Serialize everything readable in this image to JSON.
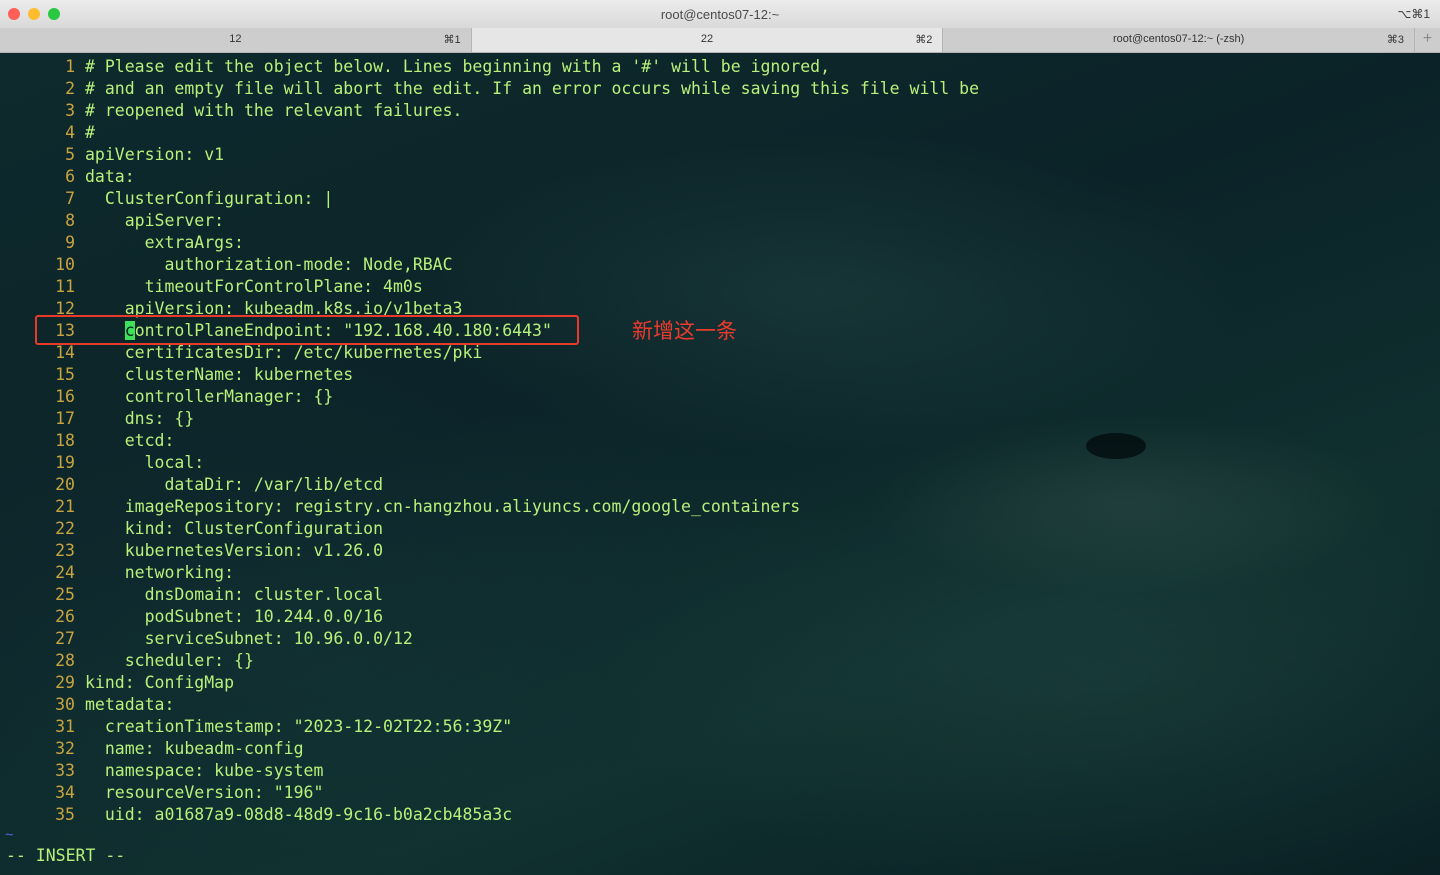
{
  "window": {
    "title": "root@centos07-12:~",
    "shortcut": "⌥⌘1"
  },
  "tabs": [
    {
      "label": "12",
      "key": "⌘1"
    },
    {
      "label": "22",
      "key": "⌘2"
    },
    {
      "label": "root@centos07-12:~ (-zsh)",
      "key": "⌘3"
    }
  ],
  "tab_add": "+",
  "editor": {
    "lines": [
      "# Please edit the object below. Lines beginning with a '#' will be ignored,",
      "# and an empty file will abort the edit. If an error occurs while saving this file will be",
      "# reopened with the relevant failures.",
      "#",
      "apiVersion: v1",
      "data:",
      "  ClusterConfiguration: |",
      "    apiServer:",
      "      extraArgs:",
      "        authorization-mode: Node,RBAC",
      "      timeoutForControlPlane: 4m0s",
      "    apiVersion: kubeadm.k8s.io/v1beta3",
      "    controlPlaneEndpoint: \"192.168.40.180:6443\"",
      "    certificatesDir: /etc/kubernetes/pki",
      "    clusterName: kubernetes",
      "    controllerManager: {}",
      "    dns: {}",
      "    etcd:",
      "      local:",
      "        dataDir: /var/lib/etcd",
      "    imageRepository: registry.cn-hangzhou.aliyuncs.com/google_containers",
      "    kind: ClusterConfiguration",
      "    kubernetesVersion: v1.26.0",
      "    networking:",
      "      dnsDomain: cluster.local",
      "      podSubnet: 10.244.0.0/16",
      "      serviceSubnet: 10.96.0.0/12",
      "    scheduler: {}",
      "kind: ConfigMap",
      "metadata:",
      "  creationTimestamp: \"2023-12-02T22:56:39Z\"",
      "  name: kubeadm-config",
      "  namespace: kube-system",
      "  resourceVersion: \"196\"",
      "  uid: a01687a9-08d8-48d9-9c16-b0a2cb485a3c"
    ],
    "cursor_line": 13,
    "tilde": "~",
    "mode": "-- INSERT --"
  },
  "annotation": {
    "text": "新增这一条",
    "line": 13
  },
  "colors": {
    "code": "#b8f07a",
    "line_number": "#c9a43f",
    "cursor": "#3fe05a",
    "annotation": "#e8392a"
  }
}
